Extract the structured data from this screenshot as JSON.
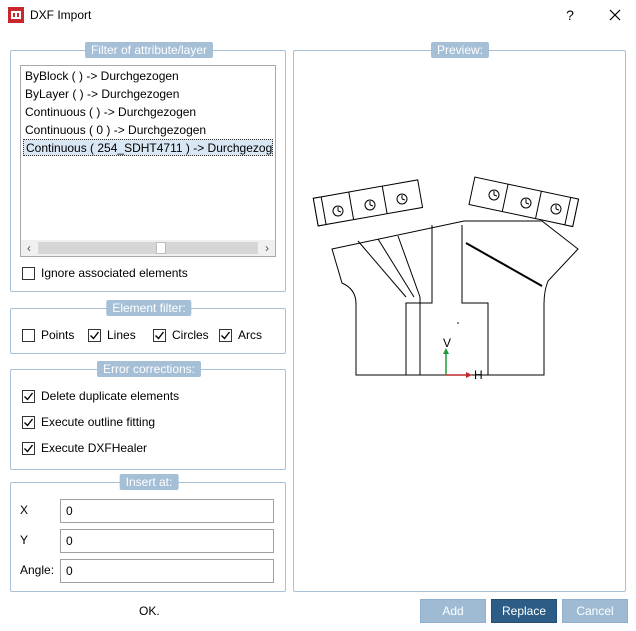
{
  "window": {
    "title": "DXF Import",
    "help": "?"
  },
  "filter_group": {
    "title": "Filter of attribute/layer",
    "items": [
      "ByBlock ( ) -> Durchgezogen",
      "ByLayer ( ) -> Durchgezogen",
      "Continuous ( ) -> Durchgezogen",
      "Continuous ( 0 ) -> Durchgezogen",
      "Continuous ( 254_SDHT4711 ) -> Durchgezog..."
    ],
    "selected_index": 4,
    "ignore_label": "Ignore associated elements",
    "ignore_checked": false
  },
  "element_filter": {
    "title": "Element filter:",
    "options": [
      {
        "label": "Points",
        "checked": false
      },
      {
        "label": "Lines",
        "checked": true
      },
      {
        "label": "Circles",
        "checked": true
      },
      {
        "label": "Arcs",
        "checked": true
      }
    ]
  },
  "error_corrections": {
    "title": "Error corrections:",
    "options": [
      {
        "label": "Delete duplicate elements",
        "checked": true
      },
      {
        "label": "Execute outline fitting",
        "checked": true
      },
      {
        "label": "Execute DXFHealer",
        "checked": true
      }
    ]
  },
  "insert_at": {
    "title": "Insert at:",
    "x_label": "X",
    "x_value": "0",
    "y_label": "Y",
    "y_value": "0",
    "angle_label": "Angle:",
    "angle_value": "0"
  },
  "preview": {
    "title": "Preview:",
    "axis_v": "V",
    "axis_h": "H"
  },
  "footer": {
    "ok_label": "OK.",
    "add_label": "Add",
    "replace_label": "Replace",
    "cancel_label": "Cancel"
  },
  "colors": {
    "accent": "#a5bfd6",
    "primary_button": "#2b5d86",
    "axis_v": "#1e9a3a",
    "axis_h": "#c0282d"
  }
}
